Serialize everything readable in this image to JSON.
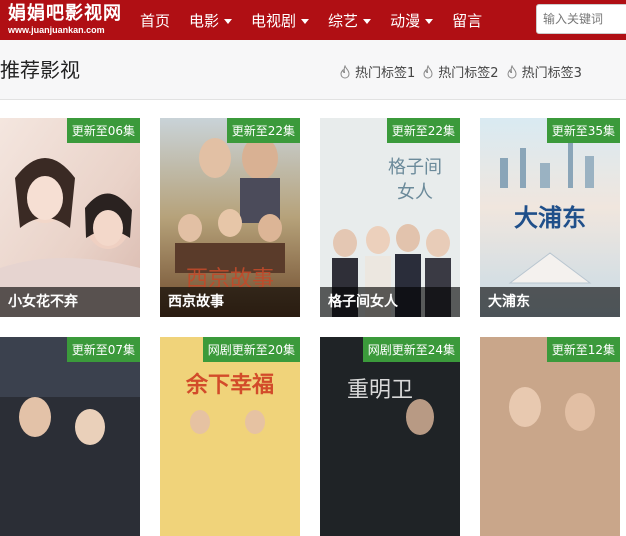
{
  "site": {
    "name": "娟娟吧影视网",
    "url": "www.juanjuankan.com"
  },
  "nav": {
    "items": [
      {
        "label": "首页",
        "dropdown": false
      },
      {
        "label": "电影",
        "dropdown": true
      },
      {
        "label": "电视剧",
        "dropdown": true
      },
      {
        "label": "综艺",
        "dropdown": true
      },
      {
        "label": "动漫",
        "dropdown": true
      },
      {
        "label": "留言",
        "dropdown": false
      }
    ]
  },
  "search": {
    "placeholder": "输入关键词"
  },
  "section": {
    "title": "推荐影视",
    "hot_tags": [
      "热门标签1",
      "热门标签2",
      "热门标签3"
    ]
  },
  "cards": [
    {
      "title": "小女花不弃",
      "badge": "更新至06集",
      "icon": "poster-image"
    },
    {
      "title": "西京故事",
      "badge": "更新至22集",
      "icon": "poster-image"
    },
    {
      "title": "格子间女人",
      "badge": "更新至22集",
      "icon": "poster-image"
    },
    {
      "title": "大浦东",
      "badge": "更新至35集",
      "icon": "poster-image"
    },
    {
      "title": "",
      "badge": "更新至07集",
      "icon": "poster-image"
    },
    {
      "title": "",
      "badge": "网剧更新至20集",
      "icon": "poster-image"
    },
    {
      "title": "",
      "badge": "网剧更新至24集",
      "icon": "poster-image"
    },
    {
      "title": "",
      "badge": "更新至12集",
      "icon": "poster-image"
    }
  ],
  "colors": {
    "brand_red": "#b00f14",
    "badge_green": "#3b9a3b"
  }
}
